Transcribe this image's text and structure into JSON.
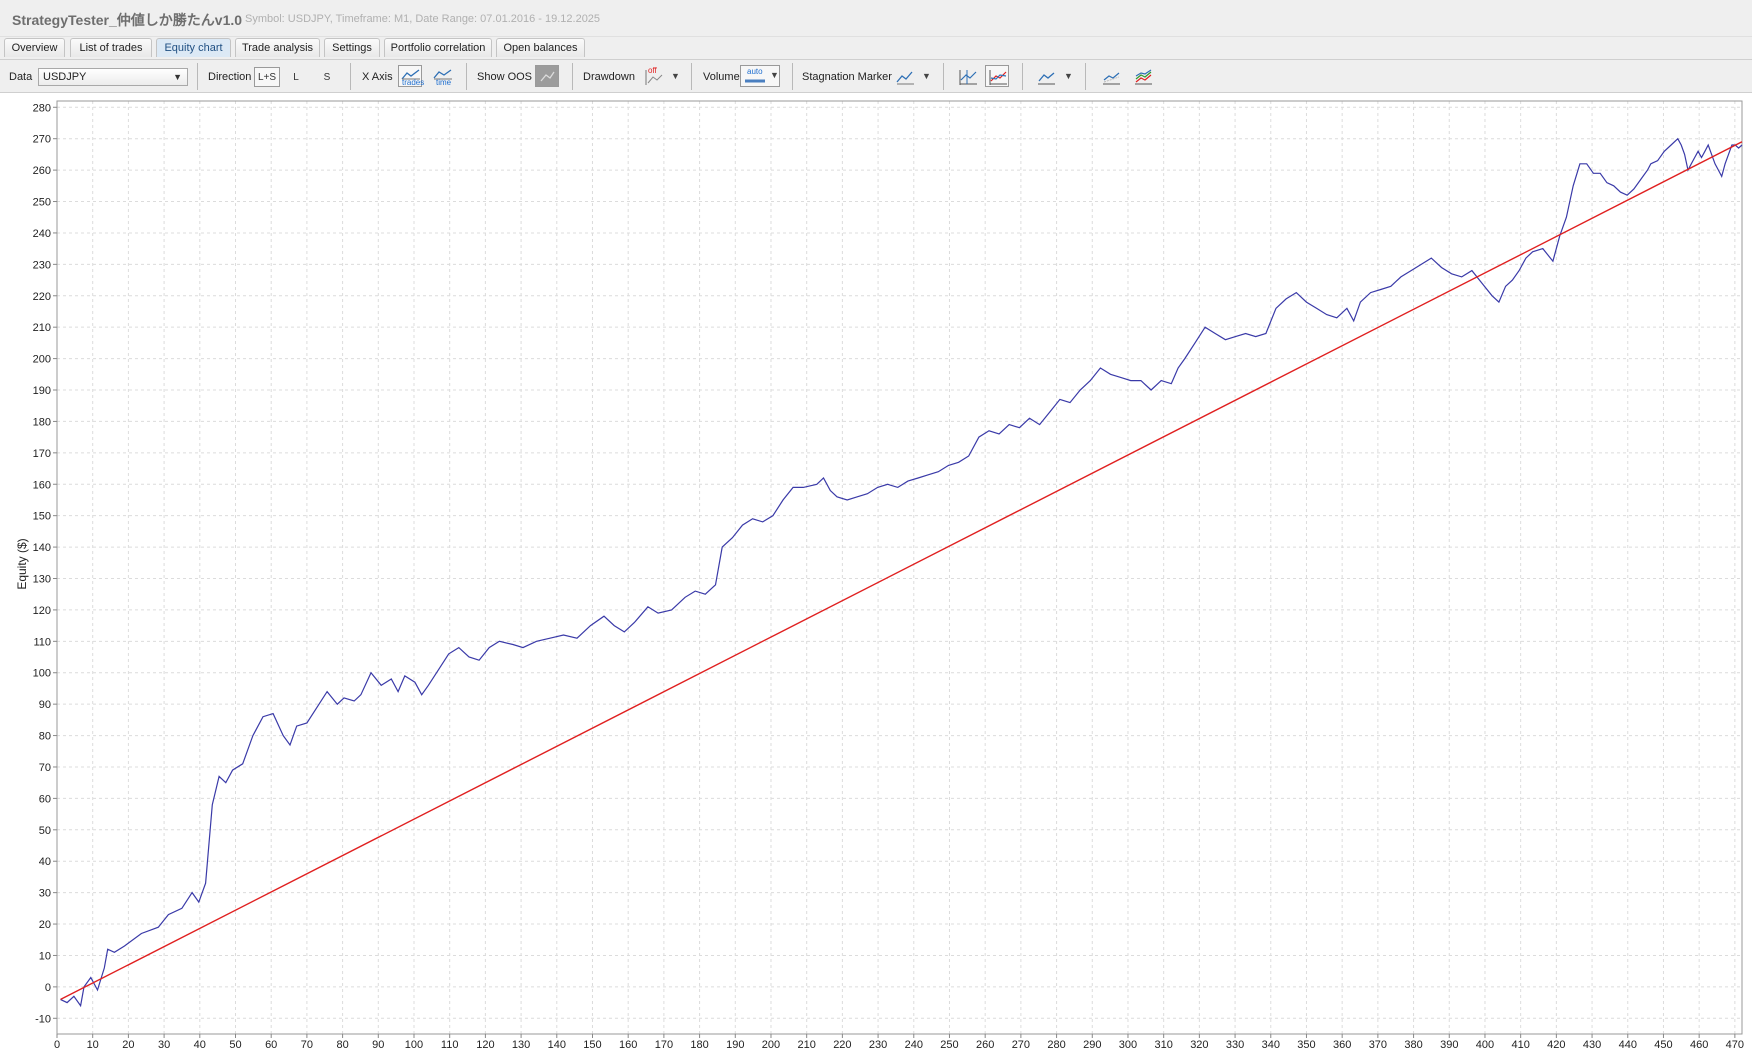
{
  "window": {
    "title": "StrategyTester_仲値しか勝たんv1.0",
    "subtitle": "Symbol: USDJPY, Timeframe: M1, Date Range: 07.01.2016 - 19.12.2025"
  },
  "tabs": [
    "Overview",
    "List of trades",
    "Equity chart",
    "Trade analysis",
    "Settings",
    "Portfolio correlation",
    "Open balances"
  ],
  "active_tab": "Equity chart",
  "toolbar": {
    "data_label": "Data",
    "data_value": "USDJPY",
    "direction_label": "Direction",
    "direction_options": [
      "L+S",
      "L",
      "S"
    ],
    "direction_selected": "L+S",
    "xaxis_label": "X Axis",
    "xaxis_trades_text": "trades",
    "xaxis_time_text": "time",
    "show_oos_label": "Show OOS",
    "drawdown_label": "Drawdown",
    "drawdown_icon_text": "off",
    "volume_label": "Volume",
    "volume_icon_text": "auto",
    "stagnation_label": "Stagnation Marker",
    "icons": [
      "chart-toggle-icon",
      "chart-compare-icon",
      "chart-type-icon",
      "line-overlay-icon",
      "multi-series-icon"
    ]
  },
  "colors": {
    "equity": "#3a3aa8",
    "trendline": "#e02020",
    "grid": "#dcdcdc",
    "tab_active": "#dce9f5"
  },
  "chart_data": {
    "type": "line",
    "ylabel": "Equity ($)",
    "xlabel": "",
    "xlim": [
      0,
      472
    ],
    "ylim": [
      -15,
      282
    ],
    "x_ticks": [
      0,
      10,
      20,
      30,
      40,
      50,
      60,
      70,
      80,
      90,
      100,
      110,
      120,
      130,
      140,
      150,
      160,
      170,
      180,
      190,
      200,
      210,
      220,
      230,
      240,
      250,
      260,
      270,
      280,
      290,
      300,
      310,
      320,
      330,
      340,
      350,
      360,
      370,
      380,
      390,
      400,
      410,
      420,
      430,
      440,
      450,
      460,
      470
    ],
    "y_ticks": [
      -10,
      0,
      10,
      20,
      30,
      40,
      50,
      60,
      70,
      80,
      90,
      100,
      110,
      120,
      130,
      140,
      150,
      160,
      170,
      180,
      190,
      200,
      210,
      220,
      230,
      240,
      250,
      260,
      270,
      280
    ],
    "grid": true,
    "series": [
      {
        "style": "equity",
        "points": [
          [
            1,
            -4
          ],
          [
            3,
            -5
          ],
          [
            5,
            -3
          ],
          [
            7,
            -6
          ],
          [
            8,
            0
          ],
          [
            10,
            3
          ],
          [
            12,
            -1
          ],
          [
            14,
            6
          ],
          [
            15,
            12
          ],
          [
            17,
            11
          ],
          [
            20,
            13
          ],
          [
            25,
            17
          ],
          [
            30,
            19
          ],
          [
            33,
            23
          ],
          [
            37,
            25
          ],
          [
            40,
            30
          ],
          [
            42,
            27
          ],
          [
            44,
            33
          ],
          [
            46,
            58
          ],
          [
            48,
            67
          ],
          [
            50,
            65
          ],
          [
            52,
            69
          ],
          [
            55,
            71
          ],
          [
            58,
            80
          ],
          [
            61,
            86
          ],
          [
            64,
            87
          ],
          [
            67,
            80
          ],
          [
            69,
            77
          ],
          [
            71,
            83
          ],
          [
            74,
            84
          ],
          [
            77,
            89
          ],
          [
            80,
            94
          ],
          [
            83,
            90
          ],
          [
            85,
            92
          ],
          [
            88,
            91
          ],
          [
            90,
            93
          ],
          [
            93,
            100
          ],
          [
            96,
            96
          ],
          [
            99,
            98
          ],
          [
            101,
            94
          ],
          [
            103,
            99
          ],
          [
            106,
            97
          ],
          [
            108,
            93
          ],
          [
            110,
            96
          ],
          [
            113,
            101
          ],
          [
            116,
            106
          ],
          [
            119,
            108
          ],
          [
            122,
            105
          ],
          [
            125,
            104
          ],
          [
            128,
            108
          ],
          [
            131,
            110
          ],
          [
            135,
            109
          ],
          [
            138,
            108
          ],
          [
            142,
            110
          ],
          [
            146,
            111
          ],
          [
            150,
            112
          ],
          [
            154,
            111
          ],
          [
            158,
            115
          ],
          [
            162,
            118
          ],
          [
            165,
            115
          ],
          [
            168,
            113
          ],
          [
            171,
            116
          ],
          [
            175,
            121
          ],
          [
            178,
            119
          ],
          [
            182,
            120
          ],
          [
            186,
            124
          ],
          [
            189,
            126
          ],
          [
            192,
            125
          ],
          [
            195,
            128
          ],
          [
            197,
            140
          ],
          [
            200,
            143
          ],
          [
            203,
            147
          ],
          [
            206,
            149
          ],
          [
            209,
            148
          ],
          [
            212,
            150
          ],
          [
            215,
            155
          ],
          [
            218,
            159
          ],
          [
            221,
            159
          ],
          [
            225,
            160
          ],
          [
            227,
            162
          ],
          [
            229,
            158
          ],
          [
            231,
            156
          ],
          [
            234,
            155
          ],
          [
            237,
            156
          ],
          [
            240,
            157
          ],
          [
            243,
            159
          ],
          [
            246,
            160
          ],
          [
            249,
            159
          ],
          [
            252,
            161
          ],
          [
            255,
            162
          ],
          [
            258,
            163
          ],
          [
            261,
            164
          ],
          [
            264,
            166
          ],
          [
            267,
            167
          ],
          [
            270,
            169
          ],
          [
            273,
            175
          ],
          [
            276,
            177
          ],
          [
            279,
            176
          ],
          [
            282,
            179
          ],
          [
            285,
            178
          ],
          [
            288,
            181
          ],
          [
            291,
            179
          ],
          [
            294,
            183
          ],
          [
            297,
            187
          ],
          [
            300,
            186
          ],
          [
            303,
            190
          ],
          [
            306,
            193
          ],
          [
            309,
            197
          ],
          [
            312,
            195
          ],
          [
            315,
            194
          ],
          [
            318,
            193
          ],
          [
            321,
            193
          ],
          [
            324,
            190
          ],
          [
            327,
            193
          ],
          [
            330,
            192
          ],
          [
            332,
            197
          ],
          [
            334,
            200
          ],
          [
            337,
            205
          ],
          [
            340,
            210
          ],
          [
            343,
            208
          ],
          [
            346,
            206
          ],
          [
            349,
            207
          ],
          [
            352,
            208
          ],
          [
            355,
            207
          ],
          [
            358,
            208
          ],
          [
            361,
            216
          ],
          [
            364,
            219
          ],
          [
            367,
            221
          ],
          [
            370,
            218
          ],
          [
            373,
            216
          ],
          [
            376,
            214
          ],
          [
            379,
            213
          ],
          [
            382,
            216
          ],
          [
            384,
            212
          ],
          [
            386,
            218
          ],
          [
            389,
            221
          ],
          [
            392,
            222
          ],
          [
            395,
            223
          ],
          [
            398,
            226
          ],
          [
            401,
            228
          ],
          [
            404,
            230
          ],
          [
            407,
            232
          ],
          [
            410,
            229
          ],
          [
            413,
            227
          ],
          [
            416,
            226
          ],
          [
            419,
            228
          ],
          [
            422,
            224
          ],
          [
            425,
            220
          ],
          [
            427,
            218
          ],
          [
            429,
            223
          ],
          [
            431,
            225
          ],
          [
            433,
            228
          ],
          [
            435,
            232
          ],
          [
            437,
            234
          ],
          [
            440,
            235
          ],
          [
            443,
            231
          ],
          [
            445,
            239
          ],
          [
            447,
            245
          ],
          [
            449,
            255
          ],
          [
            451,
            262
          ],
          [
            453,
            262
          ],
          [
            455,
            259
          ],
          [
            457,
            259
          ],
          [
            459,
            256
          ],
          [
            461,
            255
          ],
          [
            463,
            253
          ],
          [
            465,
            252
          ],
          [
            467,
            254
          ],
          [
            469,
            257
          ],
          [
            471,
            260
          ],
          [
            472,
            262
          ],
          [
            474,
            263
          ],
          [
            476,
            266
          ],
          [
            478,
            268
          ],
          [
            480,
            270
          ],
          [
            481,
            268
          ],
          [
            482,
            265
          ],
          [
            483,
            260
          ],
          [
            484,
            262
          ],
          [
            485,
            264
          ],
          [
            486,
            266
          ],
          [
            487,
            264
          ],
          [
            488,
            266
          ],
          [
            489,
            268
          ],
          [
            490,
            265
          ],
          [
            491,
            262
          ],
          [
            492,
            260
          ],
          [
            493,
            258
          ],
          [
            494,
            262
          ],
          [
            495,
            265
          ],
          [
            496,
            268
          ],
          [
            497,
            268
          ],
          [
            498,
            267
          ],
          [
            499,
            268
          ]
        ]
      },
      {
        "style": "trendline",
        "points": [
          [
            1,
            -4
          ],
          [
            472,
            269
          ]
        ]
      }
    ]
  }
}
